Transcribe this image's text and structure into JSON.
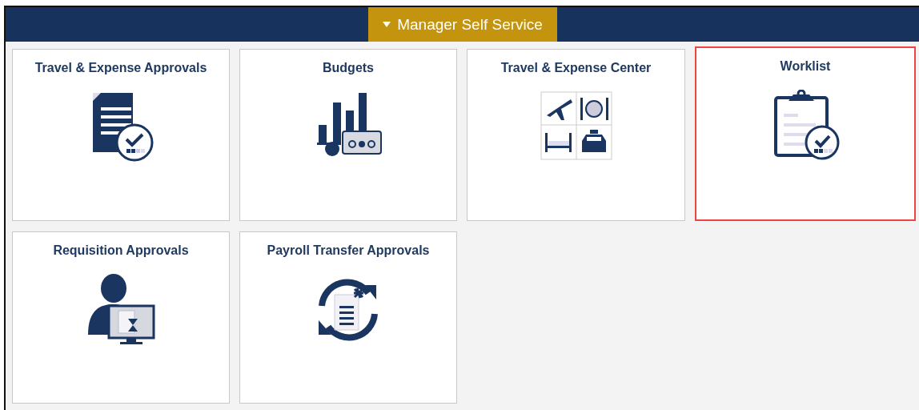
{
  "header": {
    "title": "Manager Self Service",
    "expanded": true
  },
  "tiles": [
    {
      "title": "Travel & Expense Approvals",
      "kind": "document-check",
      "highlighted": false
    },
    {
      "title": "Budgets",
      "kind": "bar-chart",
      "highlighted": false
    },
    {
      "title": "Travel & Expense Center",
      "kind": "travel-grid",
      "highlighted": false
    },
    {
      "title": "Worklist",
      "kind": "clipboard-check",
      "highlighted": true
    },
    {
      "title": "Requisition Approvals",
      "kind": "person-monitor",
      "highlighted": false
    },
    {
      "title": "Payroll Transfer Approvals",
      "kind": "sync-document",
      "highlighted": false
    }
  ]
}
